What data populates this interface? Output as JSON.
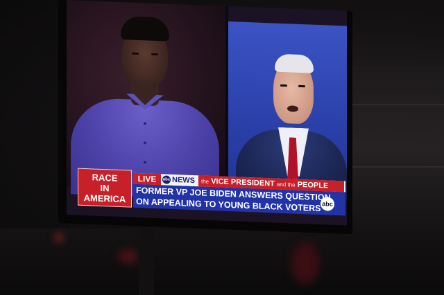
{
  "scene": {
    "description_colors": {
      "screen_left_bg": "#22121c",
      "screen_right_bg": "#2a3fa8",
      "accent_red": "#c82028",
      "accent_blue": "#2233a6"
    }
  },
  "broadcast": {
    "race_box": {
      "line1": "RACE",
      "line2": "IN",
      "line3": "AMERICA"
    },
    "live_label": "LIVE",
    "network_label": "NEWS",
    "network_logo": "abc",
    "show_prefix_small": "the",
    "show_title_main": "VICE PRESIDENT",
    "show_title_and": "and the",
    "show_title_people": "PEOPLE",
    "headline_line1": "FORMER VP JOE BIDEN ANSWERS QUESTION",
    "headline_line2": "ON APPEALING TO YOUNG BLACK VOTERS",
    "corner_bug": "abc"
  }
}
